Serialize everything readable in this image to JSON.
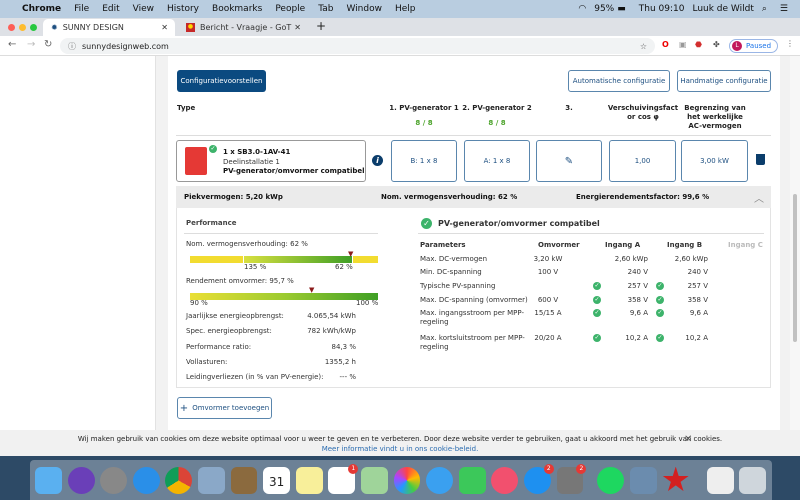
{
  "menubar": {
    "app": "Chrome",
    "items": [
      "File",
      "Edit",
      "View",
      "History",
      "Bookmarks",
      "People",
      "Tab",
      "Window",
      "Help"
    ],
    "battery": "95%",
    "clock": "Thu 09:10",
    "user": "Luuk de Wildt"
  },
  "tabs": [
    {
      "title": "SUNNY DESIGN"
    },
    {
      "title": "Bericht - Vraagje - GoT"
    }
  ],
  "address": {
    "url": "sunnydesignweb.com",
    "profile_initial": "L",
    "profile_status": "Paused"
  },
  "toolbar": {
    "proposals": "Configuratievoorstellen",
    "auto": "Automatische configuratie",
    "manual": "Handmatige configuratie"
  },
  "columns": {
    "type": "Type",
    "pv1": "1. PV-generator 1",
    "pv1_count": "8 / 8",
    "pv2": "2. PV-generator 2",
    "pv2_count": "8 / 8",
    "c3": "3.",
    "cos": "Verschuivingsfact or cos φ",
    "ac": "Begrenzing van het werkelijke AC-vermogen"
  },
  "inverter": {
    "name": "1 x SB3.0-1AV-41",
    "sub": "Deelinstallatie 1",
    "status": "PV-generator/omvormer compatibel",
    "pv1": "B: 1 x 8",
    "pv2": "A: 1 x 8",
    "cos": "1,00",
    "ac": "3,00 kW"
  },
  "summary": {
    "peak": "Piekvermogen: 5,20 kWp",
    "ratio": "Nom. vermogensverhouding: 62 %",
    "eff": "Energierendementsfactor: 99,6 %"
  },
  "performance": {
    "title": "Performance",
    "ratio_label": "Nom. vermogensverhouding: 62 %",
    "ratio_value": 62,
    "ratio_ticks": [
      "135 %",
      "62 %"
    ],
    "eff_label": "Rendement omvormer: 95,7 %",
    "eff_value": 95.7,
    "eff_ticks": [
      "90 %",
      "100 %"
    ],
    "rows": [
      {
        "k": "Jaarlijkse energieopbrengst:",
        "v": "4.065,54 kWh"
      },
      {
        "k": "Spec. energieopbrengst:",
        "v": "782 kWh/kWp"
      },
      {
        "k": "Performance ratio:",
        "v": "84,3 %"
      },
      {
        "k": "Vollasturen:",
        "v": "1355,2 h"
      },
      {
        "k": "Leidingverliezen (in % van PV-energie):",
        "v": "--- %"
      }
    ]
  },
  "compat": {
    "title": "PV-generator/omvormer compatibel",
    "headers": [
      "Parameters",
      "Omvormer",
      "Ingang A",
      "Ingang B",
      "Ingang C"
    ],
    "rows": [
      {
        "p": "Max. DC-vermogen",
        "o": "3,20 kW",
        "a": "2,60 kWp",
        "b": "2,60 kWp",
        "check": false
      },
      {
        "p": "Min. DC-spanning",
        "o": "100 V",
        "a": "240 V",
        "b": "240 V",
        "check": false
      },
      {
        "p": "Typische PV-spanning",
        "o": "",
        "a": "257 V",
        "b": "257 V",
        "check": true
      },
      {
        "p": "Max. DC-spanning (omvormer)",
        "o": "600 V",
        "a": "358 V",
        "b": "358 V",
        "check": true
      },
      {
        "p": "Max. ingangsstroom per MPP-regeling",
        "o": "15/15 A",
        "a": "9,6 A",
        "b": "9,6 A",
        "check": true
      },
      {
        "p": "Max. kortsluitstroom per MPP-regeling",
        "o": "20/20 A",
        "a": "10,2 A",
        "b": "10,2 A",
        "check": true
      }
    ]
  },
  "add_inverter": "Omvormer toevoegen",
  "cookie": {
    "text": "Wij maken gebruik van cookies om deze website optimaal voor u weer te geven en te verbeteren. Door deze website verder te gebruiken, gaat u akkoord met het gebruik van cookies.",
    "link": "Meer informatie vindt u in ons cookie-beleid."
  },
  "dock": {
    "badges": {
      "reminders": "1",
      "appstore": "2",
      "settings": "2"
    },
    "calendar_day": "31"
  },
  "colors": {
    "primary": "#0b4a80",
    "green": "#4ca32b",
    "check": "#3db36b"
  }
}
